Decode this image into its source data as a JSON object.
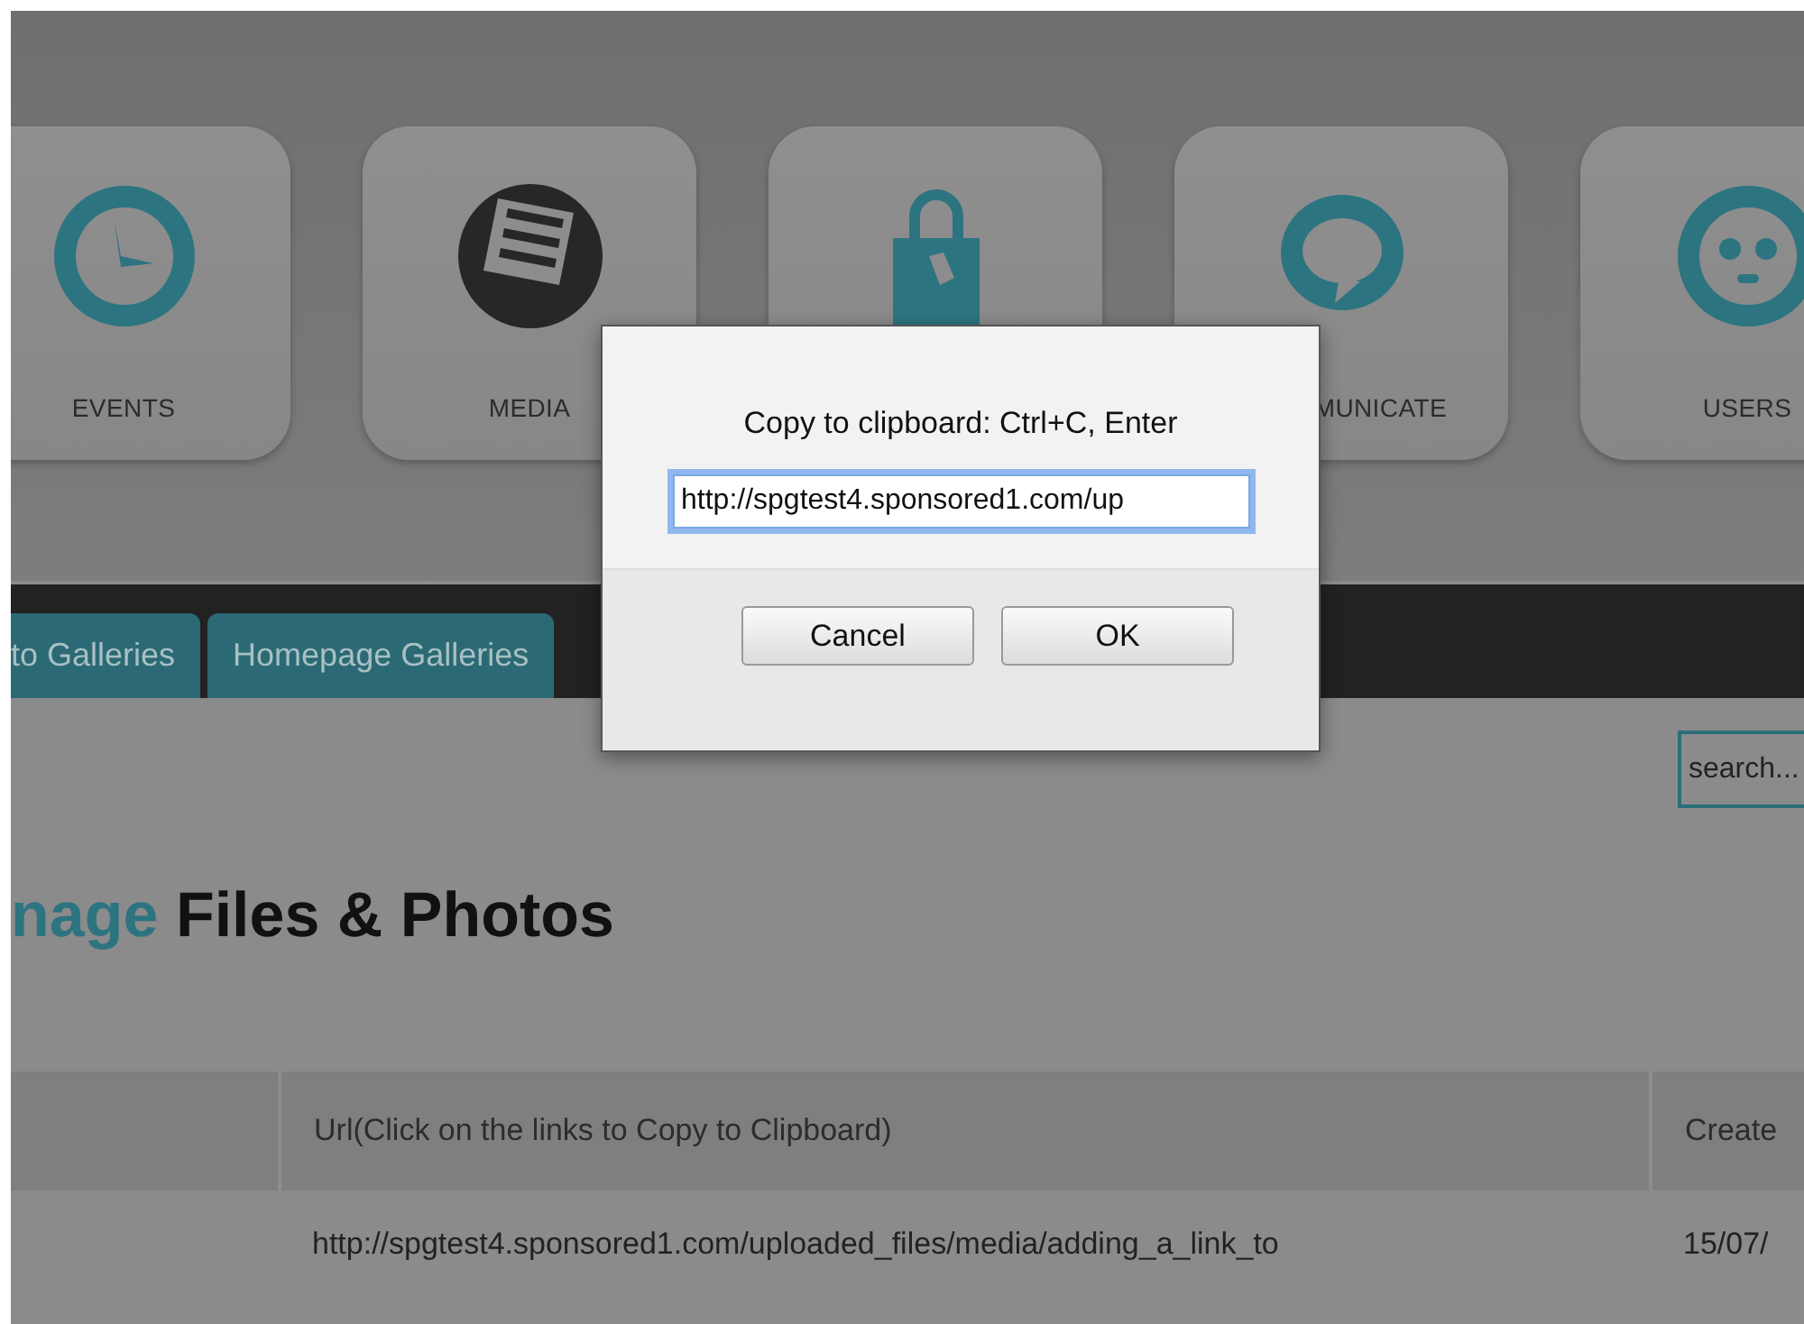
{
  "tiles": [
    {
      "kind": "clock",
      "label": "EVENTS"
    },
    {
      "kind": "document",
      "label": "MEDIA"
    },
    {
      "kind": "bag"
    },
    {
      "kind": "speech",
      "label": "MUNICATE"
    },
    {
      "kind": "face",
      "label": "USERS"
    }
  ],
  "tabs": [
    {
      "label": "to Galleries"
    },
    {
      "label": "Homepage Galleries"
    }
  ],
  "search": {
    "placeholder": "search..."
  },
  "heading": {
    "accent": "nage",
    "rest": "Files & Photos"
  },
  "table": {
    "columns": [
      "Url(Click on the links to Copy to Clipboard)",
      "Create"
    ],
    "rows": [
      {
        "cells": [
          "http://spgtest4.sponsored1.com/uploaded_files/media/adding_a_link_to",
          "15/07/"
        ]
      }
    ]
  },
  "dialog": {
    "message": "Copy to clipboard: Ctrl+C, Enter",
    "value": "http://spgtest4.sponsored1.com/up",
    "buttons": [
      "Cancel",
      "OK"
    ]
  }
}
